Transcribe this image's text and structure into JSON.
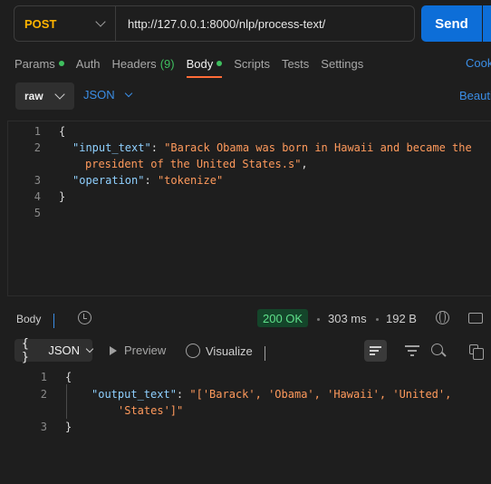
{
  "request": {
    "method": "POST",
    "url": "http://127.0.0.1:8000/nlp/process-text/",
    "send_label": "Send"
  },
  "tabs": [
    {
      "label": "Params",
      "dot": true
    },
    {
      "label": "Auth"
    },
    {
      "label": "Headers",
      "count": "(9)"
    },
    {
      "label": "Body",
      "dot": true,
      "active": true
    },
    {
      "label": "Scripts"
    },
    {
      "label": "Tests"
    },
    {
      "label": "Settings"
    }
  ],
  "cookies_label": "Cook",
  "body_options": {
    "mode": "raw",
    "language": "JSON",
    "beautify_label": "Beauti"
  },
  "request_body": {
    "line_numbers": [
      "1",
      "2",
      "3",
      "4",
      "5"
    ],
    "open_brace": "{",
    "input_key": "\"input_text\"",
    "input_value_1": "\"Barack Obama was born in Hawaii and became the",
    "input_value_2": "president of the United States.s\"",
    "operation_key": "\"operation\"",
    "operation_value": "\"tokenize\"",
    "close_brace": "}"
  },
  "response": {
    "body_label": "Body",
    "status": "200 OK",
    "time": "303 ms",
    "size": "192 B",
    "format_label": "JSON",
    "format_braces": "{ }",
    "preview_label": "Preview",
    "visualize_label": "Visualize",
    "line_numbers": [
      "1",
      "2",
      "3"
    ],
    "open_brace": "{",
    "output_key": "\"output_text\"",
    "output_value_1": "\"['Barack', 'Obama', 'Hawaii', 'United',",
    "output_value_2": "'States']\"",
    "close_brace": "}"
  },
  "colors": {
    "method": "#ffb400",
    "send": "#0d6ed8",
    "status_text": "#5fe08a",
    "json_key": "#8fd0ff",
    "json_string": "#ff9a5c",
    "link": "#3b8ee6",
    "active_tab_underline": "#ff6c37"
  },
  "icons": [
    "chevron-down-icon",
    "history-icon",
    "globe-icon",
    "save-response-icon",
    "play-icon",
    "wand-icon",
    "wrap-lines-icon",
    "filter-icon",
    "search-icon",
    "copy-icon"
  ]
}
